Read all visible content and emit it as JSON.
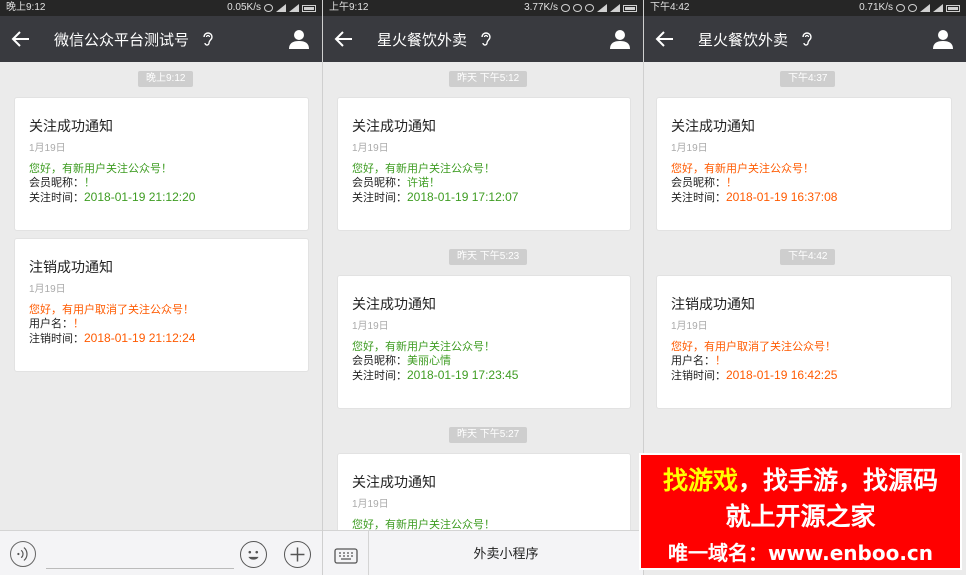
{
  "panels": [
    {
      "status": {
        "time": "晚上9:12",
        "speed": "0.05K/s"
      },
      "title": "微信公众平台测试号",
      "messages": [
        {
          "timestamp": "晚上9:12",
          "title": "关注成功通知",
          "date": "1月19日",
          "line1": "您好，有新用户关注公众号！",
          "line2_label": "会员昵称：",
          "line2_value": "！",
          "line3_label": "关注时间：",
          "line3_value": "2018-01-19 21:12:20"
        },
        {
          "title": "注销成功通知",
          "date": "1月19日",
          "line1": "您好，有用户取消了关注公众号！",
          "line2_label": "用户名：",
          "line2_value": "！",
          "line3_label": "注销时间：",
          "line3_value": "2018-01-19 21:12:24"
        }
      ]
    },
    {
      "status": {
        "time": "上午9:12",
        "speed": "3.77K/s"
      },
      "title": "星火餐饮外卖",
      "messages": [
        {
          "timestamp": "昨天 下午5:12",
          "title": "关注成功通知",
          "date": "1月19日",
          "line1": "您好，有新用户关注公众号！",
          "line2_label": "会员昵称：",
          "line2_value": "许诺！",
          "line3_label": "关注时间：",
          "line3_value": "2018-01-19 17:12:07"
        },
        {
          "timestamp": "昨天 下午5:23",
          "title": "关注成功通知",
          "date": "1月19日",
          "line1": "您好，有新用户关注公众号！",
          "line2_label": "会员昵称：",
          "line2_value": "美丽心情",
          "line3_label": "关注时间：",
          "line3_value": "2018-01-19 17:23:45"
        },
        {
          "timestamp": "昨天 下午5:27",
          "title": "关注成功通知",
          "date": "1月19日",
          "line1": "您好，有新用户关注公众号！"
        }
      ],
      "menu_label": "外卖小程序"
    },
    {
      "status": {
        "time": "下午4:42",
        "speed": "0.71K/s"
      },
      "title": "星火餐饮外卖",
      "messages": [
        {
          "timestamp": "下午4:37",
          "title": "关注成功通知",
          "date": "1月19日",
          "line1": "您好，有新用户关注公众号！",
          "line2_label": "会员昵称：",
          "line2_value": "！",
          "line3_label": "关注时间：",
          "line3_value": "2018-01-19 16:37:08"
        },
        {
          "timestamp": "下午4:42",
          "title": "注销成功通知",
          "date": "1月19日",
          "line1": "您好，有用户取消了关注公众号！",
          "line2_label": "用户名：",
          "line2_value": "！",
          "line3_label": "注销时间：",
          "line3_value": "2018-01-19 16:42:25"
        }
      ]
    }
  ],
  "watermark": {
    "line1_a": "找游戏",
    "line1_b": "，找手游，找源码",
    "line2": "就上开源之家",
    "line3": "唯一域名：www.enboo.cn"
  },
  "colors": {
    "navbar": "#393a3f",
    "green": "#3e9c22",
    "orange": "#ff5a00",
    "watermark_bg": "#ff0000"
  }
}
